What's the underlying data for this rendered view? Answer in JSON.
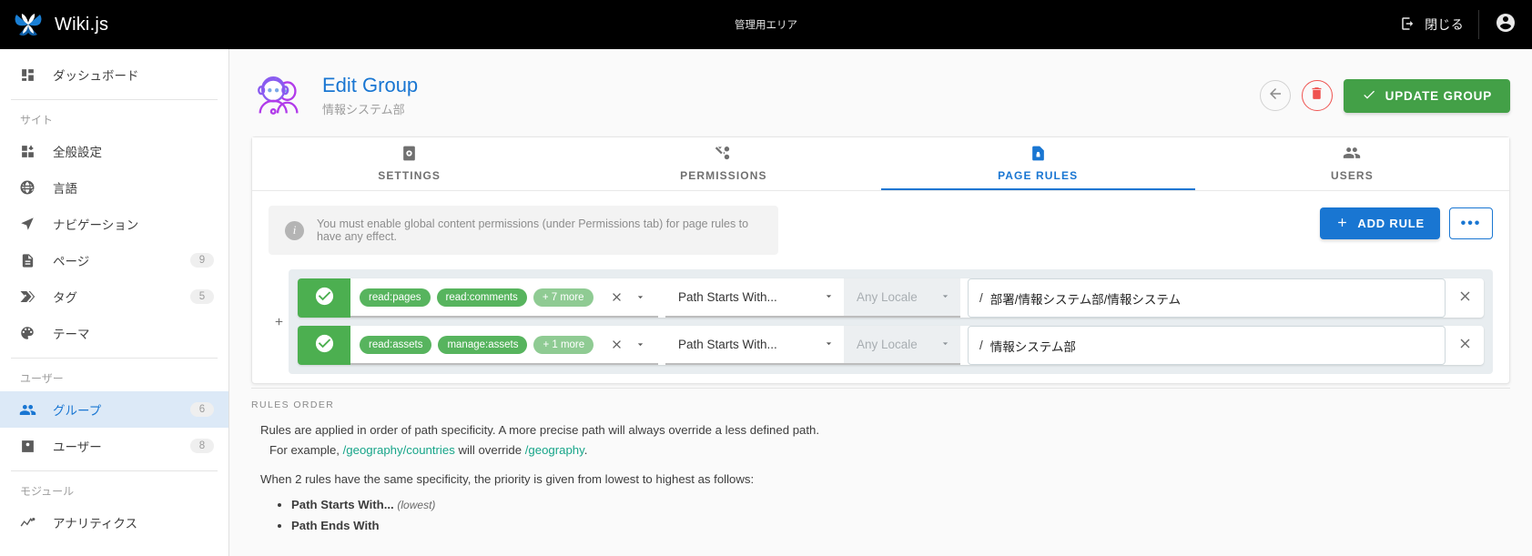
{
  "topbar": {
    "brand": "Wiki.js",
    "logo_icon": "wikijs-butterfly-logo",
    "center_label": "管理用エリア",
    "close_label": "閉じる",
    "close_icon": "exit-icon",
    "account_icon": "account-circle-icon"
  },
  "sidebar": {
    "dashboard": {
      "label": "ダッシュボード",
      "icon": "dashboard-icon"
    },
    "section_site": "サイト",
    "section_users": "ユーザー",
    "section_modules": "モジュール",
    "items_site": [
      {
        "label": "全般設定",
        "icon": "settings-grid-icon",
        "badge": ""
      },
      {
        "label": "言語",
        "icon": "globe-icon",
        "badge": ""
      },
      {
        "label": "ナビゲーション",
        "icon": "navigation-icon",
        "badge": ""
      },
      {
        "label": "ページ",
        "icon": "page-icon",
        "badge": "9"
      },
      {
        "label": "タグ",
        "icon": "tag-icon",
        "badge": "5"
      },
      {
        "label": "テーマ",
        "icon": "palette-icon",
        "badge": ""
      }
    ],
    "items_users": [
      {
        "label": "グループ",
        "icon": "group-icon",
        "badge": "6",
        "active": true
      },
      {
        "label": "ユーザー",
        "icon": "user-icon",
        "badge": "8",
        "active": false
      }
    ],
    "items_modules": [
      {
        "label": "アナリティクス",
        "icon": "analytics-icon",
        "badge": ""
      }
    ]
  },
  "page": {
    "avatar_icon": "group-avatar-icon",
    "title": "Edit Group",
    "subtitle": "情報システム部",
    "back_icon": "arrow-left-icon",
    "delete_icon": "trash-icon",
    "update_label": "UPDATE GROUP",
    "update_icon": "check-icon",
    "update_color": "#43a047"
  },
  "tabs": [
    {
      "label": "SETTINGS",
      "icon": "gear-icon",
      "active": false
    },
    {
      "label": "PERMISSIONS",
      "icon": "permissions-icon",
      "active": false
    },
    {
      "label": "PAGE RULES",
      "icon": "page-rules-icon",
      "active": true
    },
    {
      "label": "USERS",
      "icon": "users-icon",
      "active": false
    }
  ],
  "alert": {
    "icon": "info-icon",
    "text": "You must enable global content permissions (under Permissions tab) for page rules to have any effect."
  },
  "toolbar": {
    "add_rule_label": "ADD RULE",
    "add_rule_icon": "plus-icon",
    "add_rule_color": "#1976d2",
    "more_label": "•••",
    "more_icon": "dots-horizontal-icon"
  },
  "rules_panel": {
    "drag_handle_icon": "plus-drag-icon",
    "rules": [
      {
        "enabled": true,
        "toggle_icon": "check-circle-icon",
        "permissions": [
          "read:pages",
          "read:comments"
        ],
        "more_label": "+ 7 more",
        "clear_icon": "close-icon",
        "caret_icon": "chevron-down-icon",
        "match": "Path Starts With...",
        "locale_placeholder": "Any Locale",
        "path_prefix": "/",
        "path": "部署/情報システム部/情報システム",
        "delete_icon": "close-icon"
      },
      {
        "enabled": true,
        "toggle_icon": "check-circle-icon",
        "permissions": [
          "read:assets",
          "manage:assets"
        ],
        "more_label": "+ 1 more",
        "clear_icon": "close-icon",
        "caret_icon": "chevron-down-icon",
        "match": "Path Starts With...",
        "locale_placeholder": "Any Locale",
        "path_prefix": "/",
        "path": "情報システム部",
        "delete_icon": "close-icon"
      }
    ]
  },
  "rules_order": {
    "title": "RULES ORDER",
    "line1": "Rules are applied in order of path specificity. A more precise path will always override a less defined path.",
    "line2_pre": "For example, ",
    "line2_link1": "/geography/countries",
    "line2_mid": " will override ",
    "line2_link2": "/geography",
    "line2_end": ".",
    "line3": "When 2 rules have the same specificity, the priority is given from lowest to highest as follows:",
    "list": [
      {
        "label": "Path Starts With...",
        "note": "(lowest)"
      },
      {
        "label": "Path Ends With",
        "note": ""
      }
    ]
  }
}
